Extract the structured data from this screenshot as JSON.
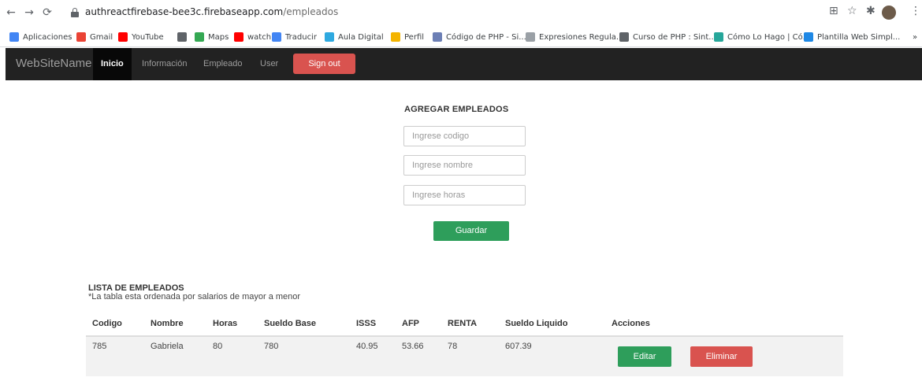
{
  "browser": {
    "url_host": "authreactfirebase-bee3c.firebaseapp.com",
    "url_path": "/empleados"
  },
  "bookmarks": [
    {
      "label": "Aplicaciones",
      "icon": "apps-grid-icon",
      "color": "#4285f4"
    },
    {
      "label": "Gmail",
      "icon": "gmail-icon",
      "color": "#ea4335"
    },
    {
      "label": "YouTube",
      "icon": "youtube-icon",
      "color": "#ff0000"
    },
    {
      "label": "",
      "icon": "globe-icon",
      "color": "#5f6368"
    },
    {
      "label": "Maps",
      "icon": "maps-icon",
      "color": "#34a853"
    },
    {
      "label": "watch",
      "icon": "youtube-icon",
      "color": "#ff0000"
    },
    {
      "label": "Traducir",
      "icon": "translate-icon",
      "color": "#4285f4"
    },
    {
      "label": "Aula Digital",
      "icon": "aula-icon",
      "color": "#2ea9e0"
    },
    {
      "label": "Perfil",
      "icon": "perfil-icon",
      "color": "#f4b400"
    },
    {
      "label": "Código de PHP - Si...",
      "icon": "php-icon",
      "color": "#6c7fb5"
    },
    {
      "label": "Expresiones Regula...",
      "icon": "regex-icon",
      "color": "#9aa0a6"
    },
    {
      "label": "Curso de PHP : Sint...",
      "icon": "globe-icon",
      "color": "#5f6368"
    },
    {
      "label": "Cómo Lo Hago | Có...",
      "icon": "comolohago-icon",
      "color": "#26a69a"
    },
    {
      "label": "Plantilla Web Simpl...",
      "icon": "plantilla-icon",
      "color": "#1e88e5"
    }
  ],
  "navbar": {
    "brand": "WebSiteName",
    "items": [
      "Inicio",
      "Información",
      "Empleado",
      "User"
    ],
    "active": "Inicio",
    "signout": "Sign out"
  },
  "form": {
    "title": "AGREGAR EMPLEADOS",
    "codigo_placeholder": "Ingrese codigo",
    "nombre_placeholder": "Ingrese nombre",
    "horas_placeholder": "Ingrese horas",
    "save_label": "Guardar"
  },
  "list": {
    "title": "LISTA DE EMPLEADOS",
    "note": "*La tabla esta ordenada por salarios de mayor a menor",
    "columns": [
      "Codigo",
      "Nombre",
      "Horas",
      "Sueldo Base",
      "ISSS",
      "AFP",
      "RENTA",
      "Sueldo Liquido",
      "Acciones"
    ],
    "rows": [
      {
        "codigo": "785",
        "nombre": "Gabriela",
        "horas": "80",
        "sueldo_base": "780",
        "isss": "40.95",
        "afp": "53.66",
        "renta": "78",
        "sueldo_liquido": "607.39",
        "edit_label": "Editar",
        "delete_label": "Eliminar"
      }
    ]
  }
}
